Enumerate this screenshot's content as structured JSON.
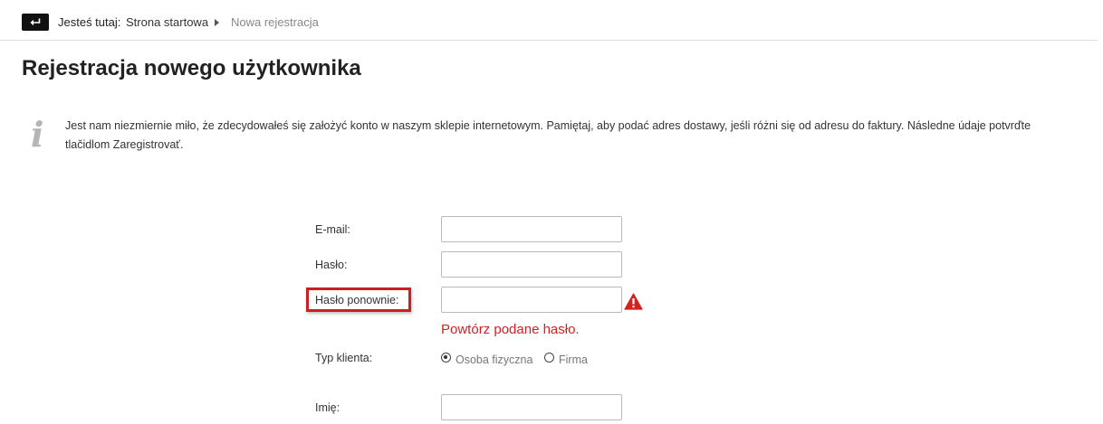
{
  "breadcrumb": {
    "label": "Jesteś tutaj:",
    "home": "Strona startowa",
    "current": "Nowa rejestracja"
  },
  "page": {
    "title": "Rejestracja nowego użytkownika"
  },
  "info": {
    "icon": "info-icon",
    "text": "Jest nam niezmiernie miło, że zdecydowałeś się założyć konto w naszym sklepie internetowym. Pamiętaj, aby podać adres dostawy, jeśli różni się od adresu do faktury. Následne údaje potvrďte tlačidlom Zaregistrovať."
  },
  "form": {
    "email": {
      "label": "E-mail:",
      "value": ""
    },
    "password": {
      "label": "Hasło:",
      "value": ""
    },
    "password_repeat": {
      "label": "Hasło ponownie:",
      "value": "",
      "error": "Powtórz podane hasło."
    },
    "client_type": {
      "label": "Typ klienta:",
      "options": [
        "Osoba fizyczna",
        "Firma"
      ],
      "selected": "Osoba fizyczna"
    },
    "first_name": {
      "label": "Imię:",
      "value": ""
    }
  },
  "colors": {
    "error": "#d42020",
    "highlight": "#cc1f1f",
    "text": "#333333"
  }
}
